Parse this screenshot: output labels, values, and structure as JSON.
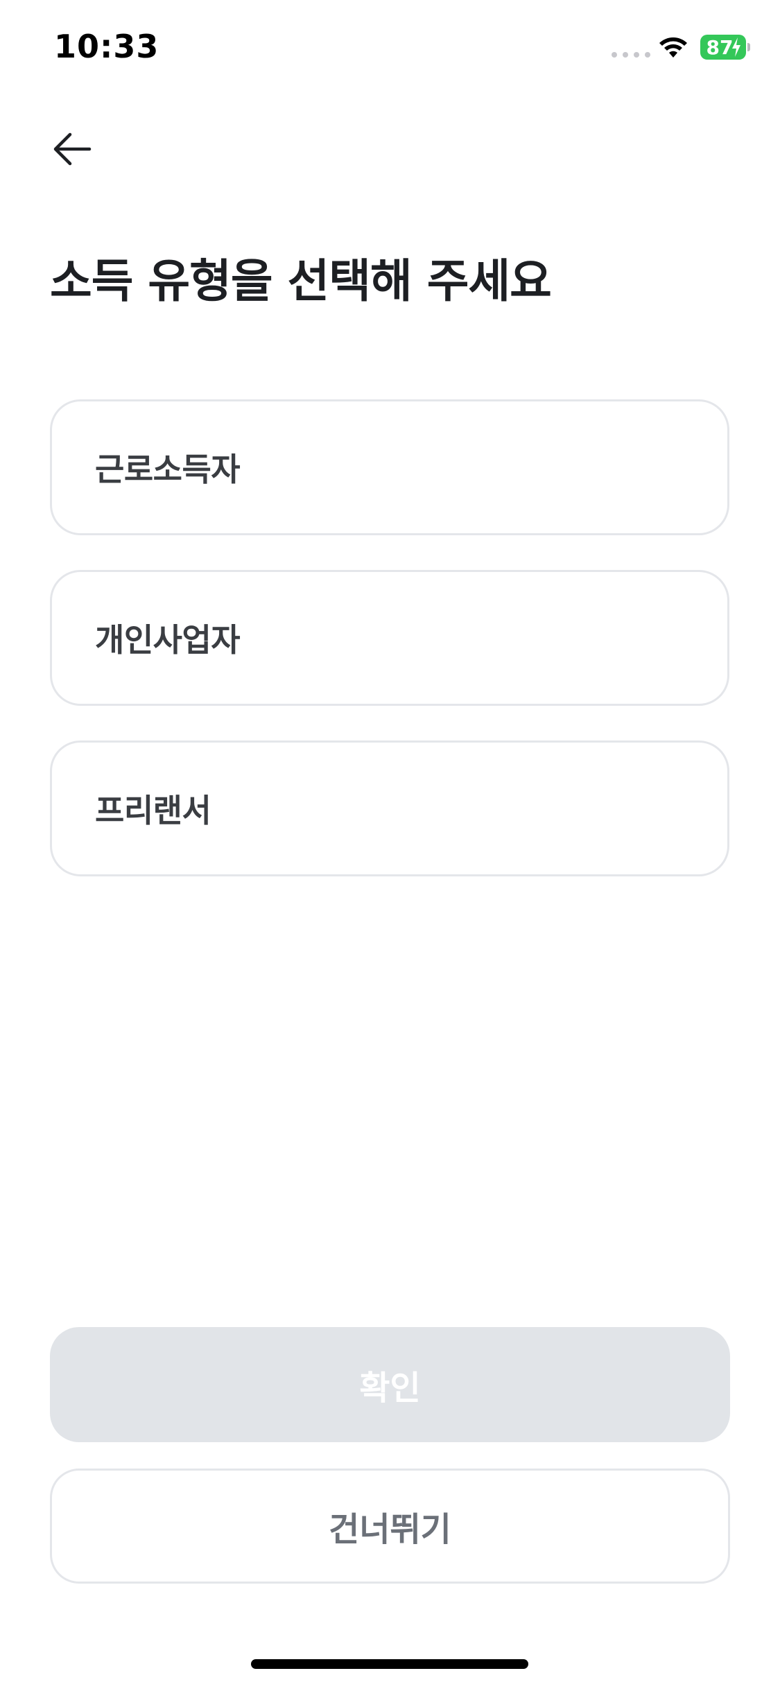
{
  "status_bar": {
    "time": "10:33",
    "battery_level": "87",
    "battery_color": "#34c759",
    "icons": [
      "signal-icon",
      "wifi-icon",
      "battery-icon",
      "charging-bolt-icon"
    ]
  },
  "nav": {
    "back_icon": "arrow-left-icon"
  },
  "page": {
    "title": "소득 유형을 선택해 주세요"
  },
  "options": [
    {
      "label": "근로소득자"
    },
    {
      "label": "개인사업자"
    },
    {
      "label": "프리랜서"
    }
  ],
  "buttons": {
    "confirm_label": "확인",
    "confirm_state": "disabled",
    "skip_label": "건너뛰기"
  },
  "colors": {
    "title_text": "#1d1f23",
    "card_border": "#e4e6ea",
    "confirm_disabled_bg": "#e1e4e8",
    "skip_text": "#6b7078"
  }
}
